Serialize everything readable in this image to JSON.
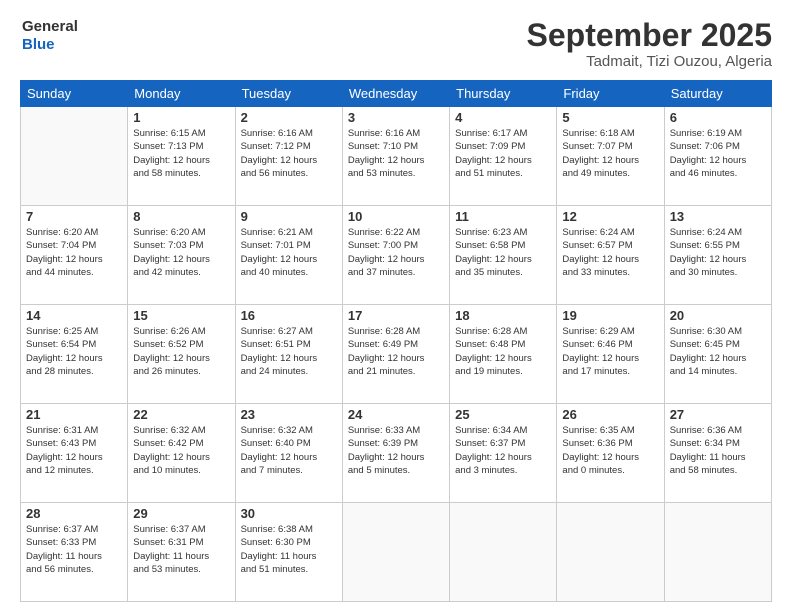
{
  "logo": {
    "line1": "General",
    "line2": "Blue"
  },
  "header": {
    "month": "September 2025",
    "location": "Tadmait, Tizi Ouzou, Algeria"
  },
  "weekdays": [
    "Sunday",
    "Monday",
    "Tuesday",
    "Wednesday",
    "Thursday",
    "Friday",
    "Saturday"
  ],
  "weeks": [
    [
      {
        "day": "",
        "info": ""
      },
      {
        "day": "1",
        "info": "Sunrise: 6:15 AM\nSunset: 7:13 PM\nDaylight: 12 hours\nand 58 minutes."
      },
      {
        "day": "2",
        "info": "Sunrise: 6:16 AM\nSunset: 7:12 PM\nDaylight: 12 hours\nand 56 minutes."
      },
      {
        "day": "3",
        "info": "Sunrise: 6:16 AM\nSunset: 7:10 PM\nDaylight: 12 hours\nand 53 minutes."
      },
      {
        "day": "4",
        "info": "Sunrise: 6:17 AM\nSunset: 7:09 PM\nDaylight: 12 hours\nand 51 minutes."
      },
      {
        "day": "5",
        "info": "Sunrise: 6:18 AM\nSunset: 7:07 PM\nDaylight: 12 hours\nand 49 minutes."
      },
      {
        "day": "6",
        "info": "Sunrise: 6:19 AM\nSunset: 7:06 PM\nDaylight: 12 hours\nand 46 minutes."
      }
    ],
    [
      {
        "day": "7",
        "info": "Sunrise: 6:20 AM\nSunset: 7:04 PM\nDaylight: 12 hours\nand 44 minutes."
      },
      {
        "day": "8",
        "info": "Sunrise: 6:20 AM\nSunset: 7:03 PM\nDaylight: 12 hours\nand 42 minutes."
      },
      {
        "day": "9",
        "info": "Sunrise: 6:21 AM\nSunset: 7:01 PM\nDaylight: 12 hours\nand 40 minutes."
      },
      {
        "day": "10",
        "info": "Sunrise: 6:22 AM\nSunset: 7:00 PM\nDaylight: 12 hours\nand 37 minutes."
      },
      {
        "day": "11",
        "info": "Sunrise: 6:23 AM\nSunset: 6:58 PM\nDaylight: 12 hours\nand 35 minutes."
      },
      {
        "day": "12",
        "info": "Sunrise: 6:24 AM\nSunset: 6:57 PM\nDaylight: 12 hours\nand 33 minutes."
      },
      {
        "day": "13",
        "info": "Sunrise: 6:24 AM\nSunset: 6:55 PM\nDaylight: 12 hours\nand 30 minutes."
      }
    ],
    [
      {
        "day": "14",
        "info": "Sunrise: 6:25 AM\nSunset: 6:54 PM\nDaylight: 12 hours\nand 28 minutes."
      },
      {
        "day": "15",
        "info": "Sunrise: 6:26 AM\nSunset: 6:52 PM\nDaylight: 12 hours\nand 26 minutes."
      },
      {
        "day": "16",
        "info": "Sunrise: 6:27 AM\nSunset: 6:51 PM\nDaylight: 12 hours\nand 24 minutes."
      },
      {
        "day": "17",
        "info": "Sunrise: 6:28 AM\nSunset: 6:49 PM\nDaylight: 12 hours\nand 21 minutes."
      },
      {
        "day": "18",
        "info": "Sunrise: 6:28 AM\nSunset: 6:48 PM\nDaylight: 12 hours\nand 19 minutes."
      },
      {
        "day": "19",
        "info": "Sunrise: 6:29 AM\nSunset: 6:46 PM\nDaylight: 12 hours\nand 17 minutes."
      },
      {
        "day": "20",
        "info": "Sunrise: 6:30 AM\nSunset: 6:45 PM\nDaylight: 12 hours\nand 14 minutes."
      }
    ],
    [
      {
        "day": "21",
        "info": "Sunrise: 6:31 AM\nSunset: 6:43 PM\nDaylight: 12 hours\nand 12 minutes."
      },
      {
        "day": "22",
        "info": "Sunrise: 6:32 AM\nSunset: 6:42 PM\nDaylight: 12 hours\nand 10 minutes."
      },
      {
        "day": "23",
        "info": "Sunrise: 6:32 AM\nSunset: 6:40 PM\nDaylight: 12 hours\nand 7 minutes."
      },
      {
        "day": "24",
        "info": "Sunrise: 6:33 AM\nSunset: 6:39 PM\nDaylight: 12 hours\nand 5 minutes."
      },
      {
        "day": "25",
        "info": "Sunrise: 6:34 AM\nSunset: 6:37 PM\nDaylight: 12 hours\nand 3 minutes."
      },
      {
        "day": "26",
        "info": "Sunrise: 6:35 AM\nSunset: 6:36 PM\nDaylight: 12 hours\nand 0 minutes."
      },
      {
        "day": "27",
        "info": "Sunrise: 6:36 AM\nSunset: 6:34 PM\nDaylight: 11 hours\nand 58 minutes."
      }
    ],
    [
      {
        "day": "28",
        "info": "Sunrise: 6:37 AM\nSunset: 6:33 PM\nDaylight: 11 hours\nand 56 minutes."
      },
      {
        "day": "29",
        "info": "Sunrise: 6:37 AM\nSunset: 6:31 PM\nDaylight: 11 hours\nand 53 minutes."
      },
      {
        "day": "30",
        "info": "Sunrise: 6:38 AM\nSunset: 6:30 PM\nDaylight: 11 hours\nand 51 minutes."
      },
      {
        "day": "",
        "info": ""
      },
      {
        "day": "",
        "info": ""
      },
      {
        "day": "",
        "info": ""
      },
      {
        "day": "",
        "info": ""
      }
    ]
  ]
}
